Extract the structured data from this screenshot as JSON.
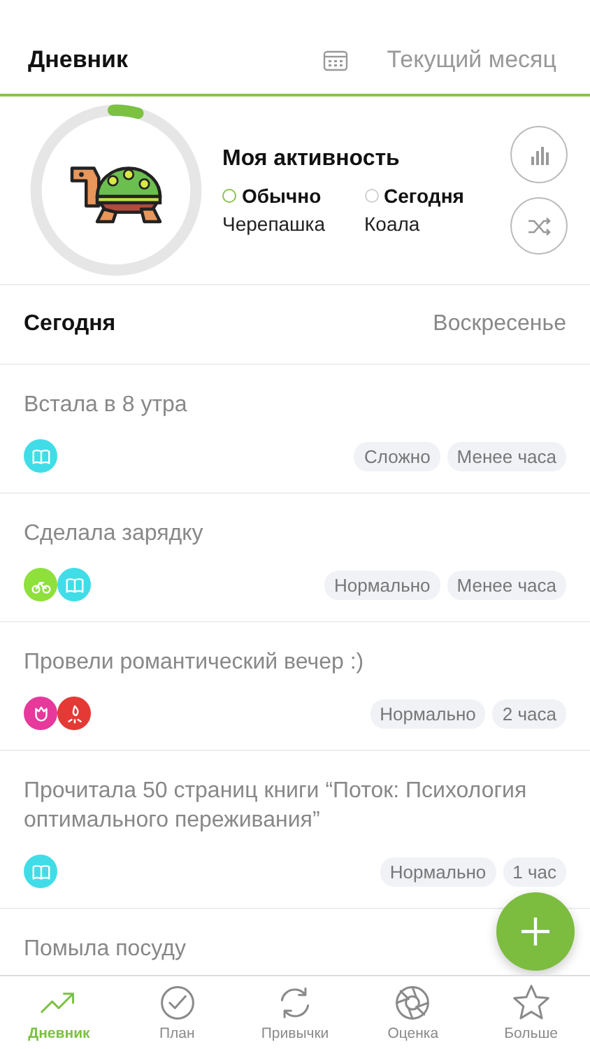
{
  "header": {
    "title": "Дневник",
    "period": "Текущий месяц"
  },
  "activity": {
    "title": "Моя активность",
    "level": 0.05,
    "legend": [
      {
        "label": "Обычно",
        "value": "Черепашка",
        "color": "#8bc34a"
      },
      {
        "label": "Сегодня",
        "value": "Коала",
        "color": "#d0d0d0"
      }
    ]
  },
  "day": {
    "title": "Сегодня",
    "weekday": "Воскресенье"
  },
  "entries": [
    {
      "text": "Встала в 8 утра",
      "icons": [
        {
          "kind": "book",
          "color": "#40dde8"
        }
      ],
      "tags": [
        "Сложно",
        "Менее часа"
      ]
    },
    {
      "text": "Сделала зарядку",
      "icons": [
        {
          "kind": "bike",
          "color": "#8ee03c"
        },
        {
          "kind": "book",
          "color": "#40dde8"
        }
      ],
      "tags": [
        "Нормально",
        "Менее часа"
      ]
    },
    {
      "text": "Провели романтический вечер :)",
      "icons": [
        {
          "kind": "flower",
          "color": "#e6399b"
        },
        {
          "kind": "fire",
          "color": "#e53935"
        }
      ],
      "tags": [
        "Нормально",
        "2 часа"
      ]
    },
    {
      "text": "Прочитала 50 страниц книги “Поток: Психология оптимального переживания”",
      "icons": [
        {
          "kind": "book",
          "color": "#40dde8"
        }
      ],
      "tags": [
        "Нормально",
        "1 час"
      ]
    },
    {
      "text": "Помыла посуду"
    }
  ],
  "tabs": [
    {
      "label": "Дневник",
      "kind": "trend",
      "selected": true
    },
    {
      "label": "План",
      "kind": "check",
      "selected": false
    },
    {
      "label": "Привычки",
      "kind": "cycle",
      "selected": false
    },
    {
      "label": "Оценка",
      "kind": "aperture",
      "selected": false
    },
    {
      "label": "Больше",
      "kind": "star",
      "selected": false
    }
  ]
}
